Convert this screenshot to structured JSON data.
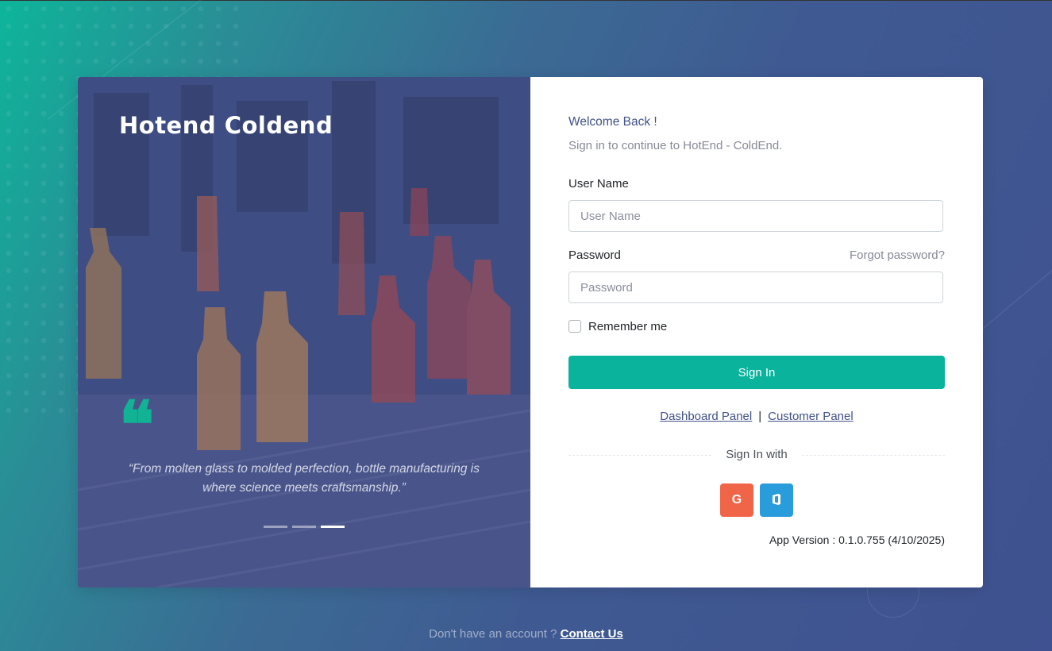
{
  "brand": {
    "name": "Hotend Coldend"
  },
  "carousel": {
    "quote": "“From molten glass to molded perfection, bottle manufacturing is where science meets craftsmanship.”",
    "slide_count": 3,
    "active_index": 2
  },
  "login": {
    "welcome": "Welcome Back !",
    "subtitle": "Sign in to continue to HotEnd - ColdEnd.",
    "username_label": "User Name",
    "username_placeholder": "User Name",
    "password_label": "Password",
    "password_placeholder": "Password",
    "forgot": "Forgot password?",
    "remember": "Remember me",
    "signin": "Sign In",
    "dashboard_link": "Dashboard Panel",
    "separator": "|",
    "customer_link": "Customer Panel",
    "signin_with": "Sign In with",
    "social": {
      "google_glyph": "G",
      "google_icon": "google-icon",
      "office_icon": "office-icon"
    },
    "version": "App Version : 0.1.0.755 (4/10/2025)"
  },
  "footer": {
    "prompt": "Don't have an account ?",
    "link": "Contact Us"
  },
  "colors": {
    "accent": "#0ab39c",
    "primary": "#405189",
    "google": "#f06548",
    "office": "#299cdb"
  }
}
